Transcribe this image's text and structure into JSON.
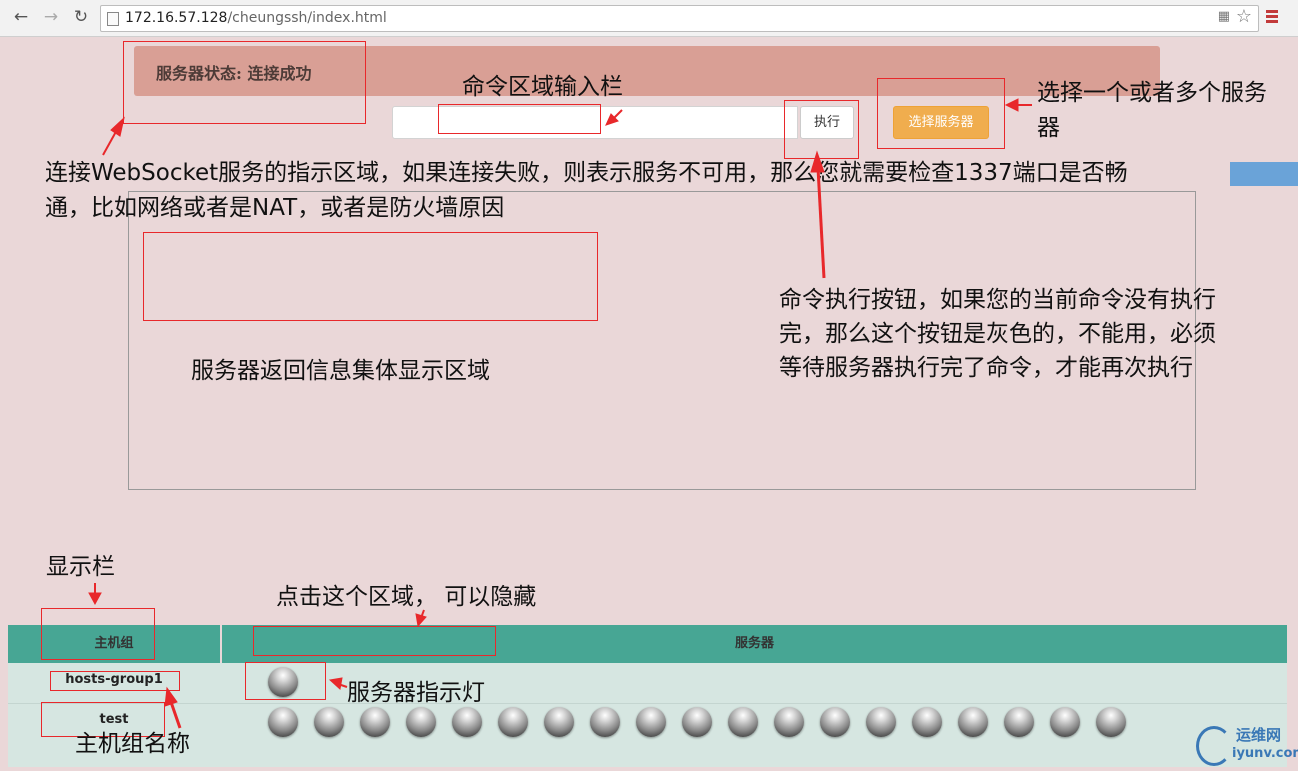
{
  "browser": {
    "url_host": "172.16.57.128",
    "url_path": "/cheungssh/index.html"
  },
  "status": {
    "text": "服务器状态: 连接成功"
  },
  "command": {
    "input_value": "",
    "exec_label": "执行",
    "select_servers_label": "选择服务器"
  },
  "side_badge": "",
  "table": {
    "col_group": "主机组",
    "col_server": "服务器",
    "rows": [
      {
        "group": "hosts-group1",
        "server_lights": 1
      },
      {
        "group": "test",
        "server_lights": 19
      }
    ]
  },
  "annotations": {
    "cmd_input_area": "命令区域输入栏",
    "select_servers": "选择一个或者多个服务器",
    "websocket_line1": "连接WebSocket服务的指示区域，如果连接失败，则表示服务不可用，那么您就需要检查1337端口是否畅",
    "websocket_line2": "通，比如网络或者是NAT，或者是防火墙原因",
    "exec_button_line1": "命令执行按钮，如果您的当前命令没有执行",
    "exec_button_line2": "完，那么这个按钮是灰色的，不能用，必须",
    "exec_button_line3": "等待服务器执行完了命令，才能再次执行",
    "output_area": "服务器返回信息集体显示区域",
    "display_bar": "显示栏",
    "hide_area": "点击这个区域， 可以隐藏",
    "server_light": "服务器指示灯",
    "group_name": "主机组名称"
  },
  "watermark": {
    "cn": "运维网",
    "en": "iyunv.com"
  },
  "colors": {
    "page_bg": "#ead7d8",
    "status_bar": "#d99f95",
    "table_header": "#47a694",
    "row_bg": "#d6e6e1",
    "select_button": "#f0ad4e",
    "annotation_red": "#e8282b"
  }
}
